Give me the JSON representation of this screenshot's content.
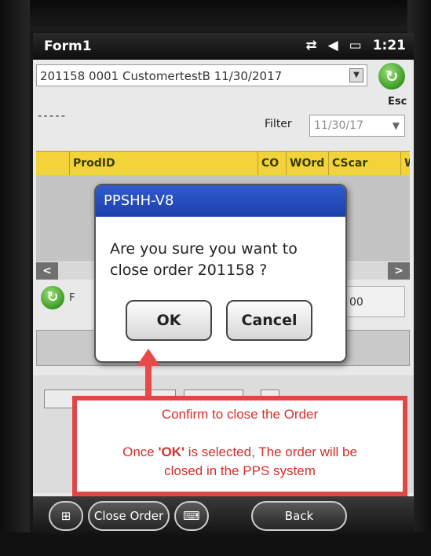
{
  "titlebar": {
    "title": "Form1",
    "time": "1:21",
    "icons": [
      "sync-icon",
      "volume-icon",
      "battery-icon"
    ]
  },
  "order_select": {
    "value": "201158 0001 CustomertestB 11/30/2017"
  },
  "esc_label": "Esc",
  "dashes": "-----",
  "filter": {
    "label": "Filter",
    "value": "11/30/17"
  },
  "grid": {
    "columns": [
      "",
      "ProdID",
      "CO",
      "WOrd",
      "CScar",
      "W"
    ]
  },
  "row": {
    "label": "F",
    "value": "00"
  },
  "dialog": {
    "title": "PPSHH-V8",
    "message": "Are you sure you want to close order 201158 ?",
    "ok_label": "OK",
    "cancel_label": "Cancel"
  },
  "callout": {
    "line1": "Confirm to close the Order",
    "line2_prefix": "Once ",
    "line2_bold": "'OK'",
    "line2_suffix": " is selected, The order will be",
    "line3": "closed in the PPS system",
    "color": "#e04646"
  },
  "softkeys": {
    "close_order_label": "Close Order",
    "back_label": "Back"
  },
  "colors": {
    "grid_header": "#f2d33a",
    "dialog_title": "#2f5bd0",
    "go_button": "#3a9a22"
  }
}
